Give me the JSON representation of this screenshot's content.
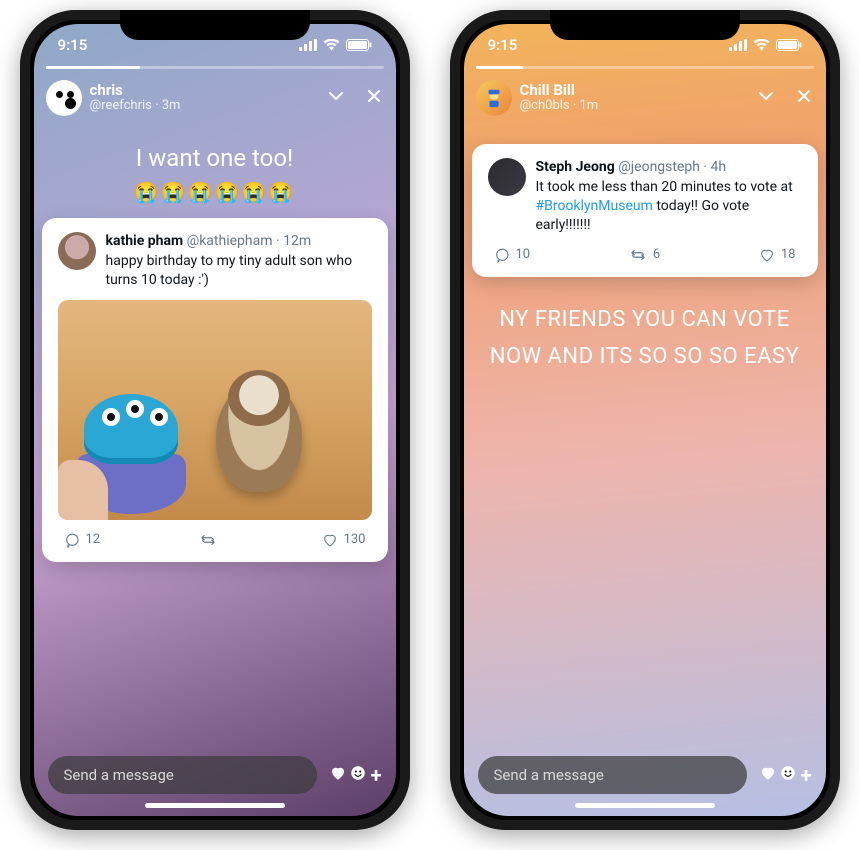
{
  "status": {
    "time": "9:15"
  },
  "footer": {
    "placeholder": "Send a message"
  },
  "phones": {
    "a": {
      "progress_width": "28%",
      "author": {
        "display_name": "chris",
        "handle_time": "@reefchris · 3m"
      },
      "caption": "I want one too!",
      "emoji_row": "😭😭😭😭😭😭",
      "tweet": {
        "name": "kathie pham",
        "handle_time": "@kathiepham · 12m",
        "body": "happy birthday to my tiny adult son who turns 10 today :')",
        "replies": "12",
        "retweets": "",
        "likes": "130"
      }
    },
    "b": {
      "progress_width": "14%",
      "author": {
        "display_name": "Chill Bill",
        "handle_time": "@ch0bls · 1m"
      },
      "tweet": {
        "name": "Steph Jeong",
        "handle_time": "@jeongsteph · 4h",
        "body_pre": "It took me less than 20 minutes to vote at ",
        "body_link": "#BrooklynMuseum",
        "body_post": " today!! Go vote early!!!!!!!",
        "replies": "10",
        "retweets": "6",
        "likes": "18"
      },
      "caption": "NY FRIENDS YOU CAN VOTE NOW AND ITS SO SO SO EASY"
    }
  }
}
